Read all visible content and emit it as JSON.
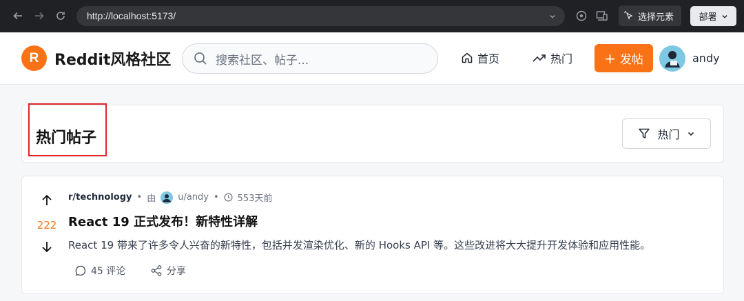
{
  "browser": {
    "url": "http://localhost:5173/",
    "select_element_label": "选择元素",
    "deploy_label": "部署"
  },
  "header": {
    "logo_letter": "R",
    "site_title": "Reddit风格社区",
    "search_placeholder": "搜索社区、帖子...",
    "nav": {
      "home_label": "首页",
      "hot_label": "热门"
    },
    "post_button_label": "发帖",
    "username": "andy"
  },
  "section": {
    "title": "热门帖子",
    "sort_label": "热门"
  },
  "posts": [
    {
      "community": "r/technology",
      "by_label": "由",
      "author": "u/andy",
      "time": "553天前",
      "score": "222",
      "title": "React 19 正式发布！新特性详解",
      "body": "React 19 带来了许多令人兴奋的新特性，包括并发渲染优化、新的 Hooks API 等。这些改进将大大提升开发体验和应用性能。",
      "comments_label": "45 评论",
      "share_label": "分享"
    }
  ],
  "colors": {
    "accent": "#f97316",
    "highlight_border": "#e02424"
  }
}
